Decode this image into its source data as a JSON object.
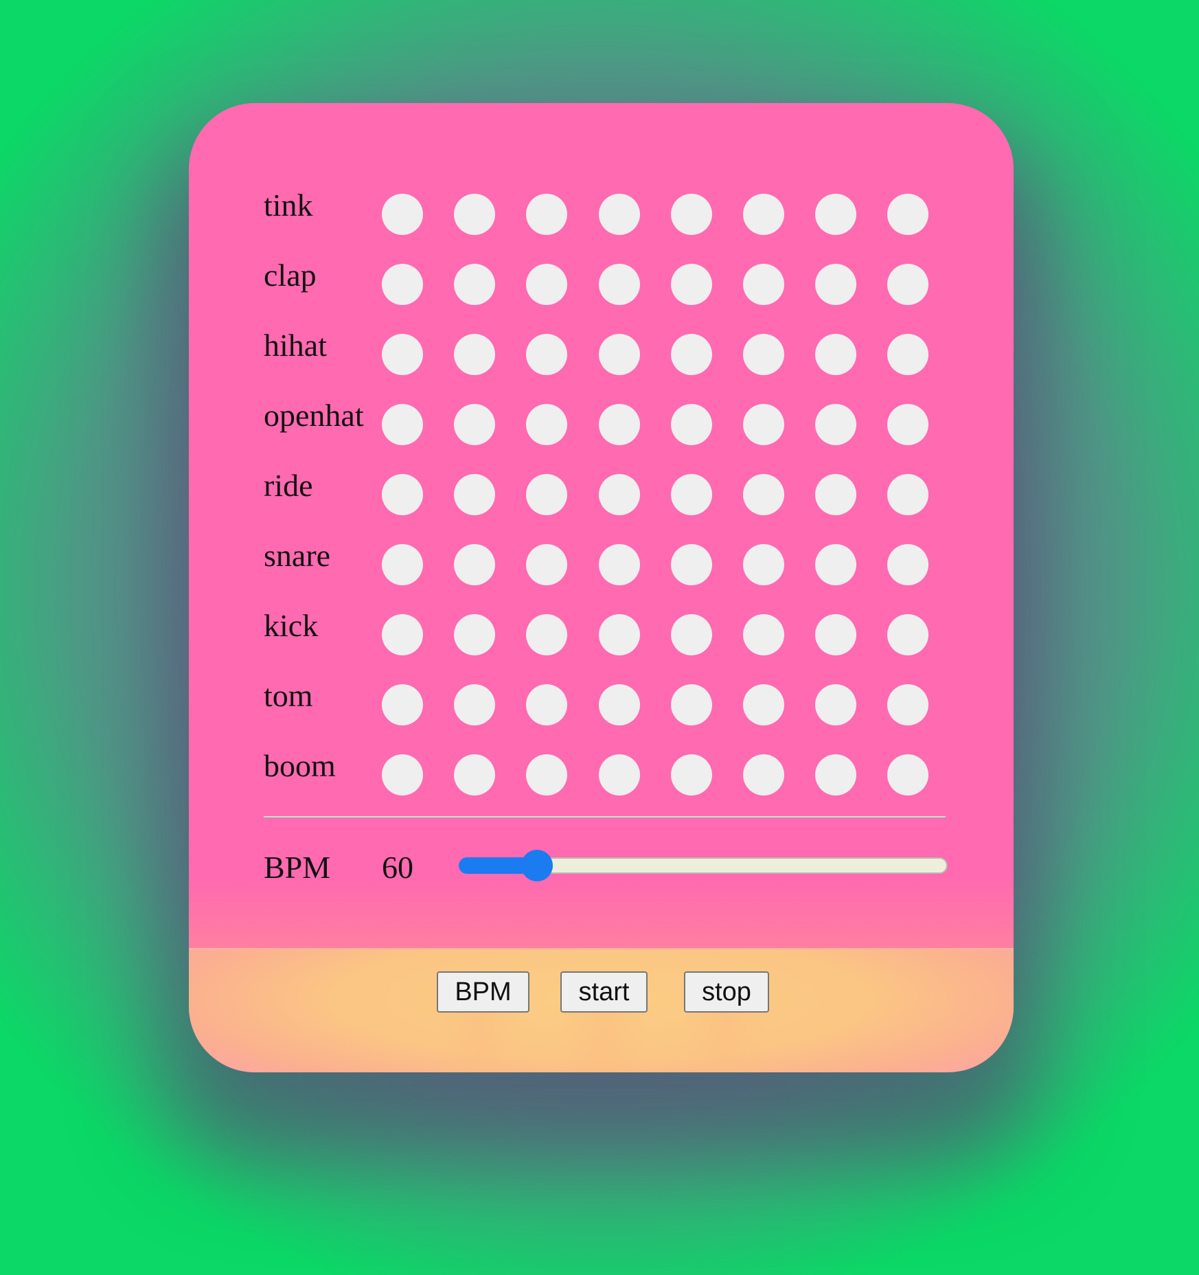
{
  "tracks": [
    {
      "label": "tink",
      "steps": [
        false,
        false,
        false,
        false,
        false,
        false,
        false,
        false
      ]
    },
    {
      "label": "clap",
      "steps": [
        false,
        false,
        false,
        false,
        false,
        false,
        false,
        false
      ]
    },
    {
      "label": "hihat",
      "steps": [
        false,
        false,
        false,
        false,
        false,
        false,
        false,
        false
      ]
    },
    {
      "label": "openhat",
      "steps": [
        false,
        false,
        false,
        false,
        false,
        false,
        false,
        false
      ]
    },
    {
      "label": "ride",
      "steps": [
        false,
        false,
        false,
        false,
        false,
        false,
        false,
        false
      ]
    },
    {
      "label": "snare",
      "steps": [
        false,
        false,
        false,
        false,
        false,
        false,
        false,
        false
      ]
    },
    {
      "label": "kick",
      "steps": [
        false,
        false,
        false,
        false,
        false,
        false,
        false,
        false
      ]
    },
    {
      "label": "tom",
      "steps": [
        false,
        false,
        false,
        false,
        false,
        false,
        false,
        false
      ]
    },
    {
      "label": "boom",
      "steps": [
        false,
        false,
        false,
        false,
        false,
        false,
        false,
        false
      ]
    }
  ],
  "bpm": {
    "label": "BPM",
    "value": "60",
    "slider_fraction": 0.16
  },
  "buttons": {
    "bpm_label": "BPM",
    "start_label": "start",
    "stop_label": "stop"
  },
  "colors": {
    "background_center": "#7a6a98",
    "background_edge": "#0bd866",
    "card": "#ff6ab0",
    "footer": "#fbc584",
    "step_inactive": "#efefef",
    "slider_accent": "#1a7cf0"
  }
}
